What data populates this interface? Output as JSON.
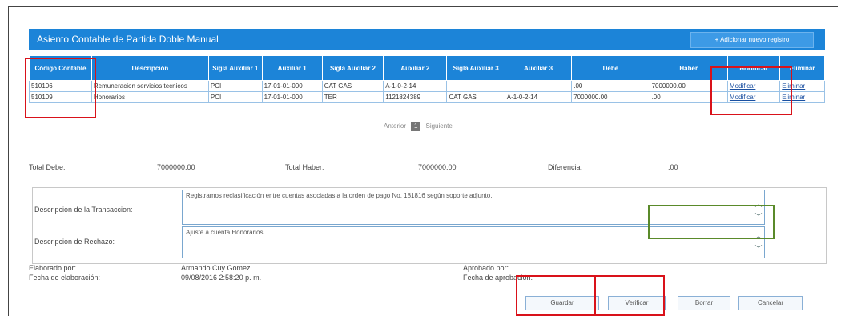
{
  "header": {
    "title": "Asiento Contable de Partida Doble Manual",
    "add_button": "+ Adicionar nuevo registro"
  },
  "table": {
    "columns": [
      "Código Contable",
      "Descripción",
      "Sigla Auxiliar 1",
      "Auxiliar 1",
      "Sigla Auxiliar 2",
      "Auxiliar 2",
      "Sigla Auxiliar 3",
      "Auxiliar 3",
      "Debe",
      "Haber",
      "Modificar",
      "Eliminar"
    ],
    "rows": [
      [
        "510106",
        "Remuneracion servicios tecnicos",
        "PCI",
        "17-01-01-000",
        "CAT GAS",
        "A-1-0-2-14",
        "",
        "",
        ".00",
        "7000000.00",
        "Modificar",
        "Eliminar"
      ],
      [
        "510109",
        "Honorarios",
        "PCI",
        "17-01-01-000",
        "TER",
        "1121824389",
        "CAT GAS",
        "A-1-0-2-14",
        "7000000.00",
        ".00",
        "Modificar",
        "Eliminar"
      ]
    ]
  },
  "pager": {
    "prev": "Anterior",
    "page": "1",
    "next": "Siguiente"
  },
  "totals": {
    "debe_label": "Total Debe:",
    "debe_value": "7000000.00",
    "haber_label": "Total Haber:",
    "haber_value": "7000000.00",
    "diff_label": "Diferencia:",
    "diff_value": ".00"
  },
  "form": {
    "transaccion_label": "Descripcion de la Transaccion:",
    "transaccion_value": "Registramos reclasificación entre cuentas asociadas a la orden de pago No. 181816 según soporte adjunto.",
    "rechazo_label": "Descripcion de Rechazo:",
    "rechazo_value": "Ajuste a cuenta Honorarios",
    "elaborado_label": "Elaborado por:",
    "elaborado_value": "Armando Cuy Gomez",
    "fecha_elab_label": "Fecha de elaboración:",
    "fecha_elab_value": "09/08/2016 2:58:20 p. m.",
    "aprobado_label": "Aprobado por:",
    "fecha_aprob_label": "Fecha de aprobación:"
  },
  "buttons": {
    "guardar": "Guardar",
    "verificar": "Verificar",
    "borrar": "Borrar",
    "cancelar": "Cancelar"
  },
  "colors": {
    "header_blue": "#1c84d8",
    "highlight_red": "#d9121a",
    "highlight_green": "#5a8a2a"
  },
  "icons": [
    "scroll-up-icon",
    "scroll-down-icon"
  ]
}
